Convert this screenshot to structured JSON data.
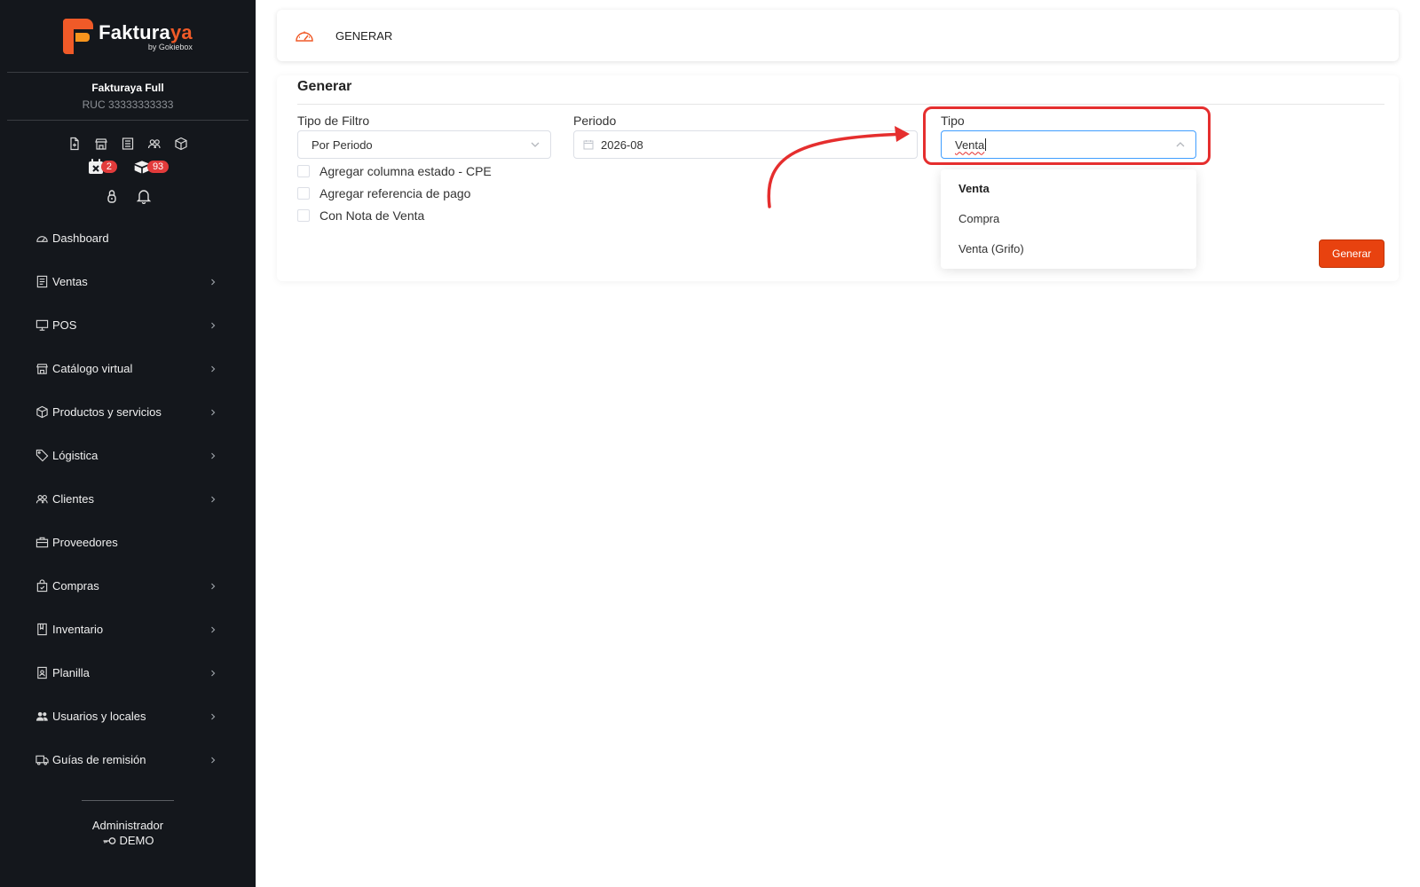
{
  "sidebar": {
    "brand": {
      "word_main": "Faktura",
      "word_accent": "ya",
      "sub": "by Gokiebox"
    },
    "company": {
      "name": "Fakturaya Full",
      "ruc": "RUC 33333333333"
    },
    "badges": {
      "calendar_count": "2",
      "boxes_count": "93"
    },
    "items": [
      {
        "label": "Dashboard",
        "icon": "dashboard-icon",
        "has_chevron": false
      },
      {
        "label": "Ventas",
        "icon": "receipt-icon",
        "has_chevron": true
      },
      {
        "label": "POS",
        "icon": "monitor-icon",
        "has_chevron": true
      },
      {
        "label": "Catálogo virtual",
        "icon": "store-icon",
        "has_chevron": true
      },
      {
        "label": "Productos y servicios",
        "icon": "box-icon",
        "has_chevron": true
      },
      {
        "label": "Lógistica",
        "icon": "tag-icon",
        "has_chevron": true
      },
      {
        "label": "Clientes",
        "icon": "users-icon",
        "has_chevron": true
      },
      {
        "label": "Proveedores",
        "icon": "briefcase-icon",
        "has_chevron": false
      },
      {
        "label": "Compras",
        "icon": "shopping-bag-icon",
        "has_chevron": true
      },
      {
        "label": "Inventario",
        "icon": "book-icon",
        "has_chevron": true
      },
      {
        "label": "Planilla",
        "icon": "id-card-icon",
        "has_chevron": true
      },
      {
        "label": "Usuarios y locales",
        "icon": "user-group-icon",
        "has_chevron": true
      },
      {
        "label": "Guías de remisión",
        "icon": "truck-icon",
        "has_chevron": true
      }
    ],
    "footer": {
      "role": "Administrador",
      "user": "DEMO"
    }
  },
  "topbar": {
    "breadcrumb": "GENERAR"
  },
  "form": {
    "title": "Generar",
    "tipo_filtro": {
      "label": "Tipo de Filtro",
      "value": "Por Periodo"
    },
    "periodo": {
      "label": "Periodo",
      "value": "2026-08"
    },
    "tipo": {
      "label": "Tipo",
      "value": "Venta"
    },
    "checkboxes": [
      {
        "label": "Agregar columna estado - CPE",
        "checked": false
      },
      {
        "label": "Agregar referencia de pago",
        "checked": false
      },
      {
        "label": "Con Nota de Venta",
        "checked": false
      }
    ],
    "tipo_options": [
      {
        "label": "Venta",
        "selected": true
      },
      {
        "label": "Compra",
        "selected": false
      },
      {
        "label": "Venta (Grifo)",
        "selected": false
      }
    ],
    "submit_label": "Generar"
  },
  "colors": {
    "accent": "#f05a28",
    "button": "#e8420f",
    "sidebar_bg": "#14171c",
    "annotation": "#e52e2e",
    "badge": "#e23b3b"
  }
}
